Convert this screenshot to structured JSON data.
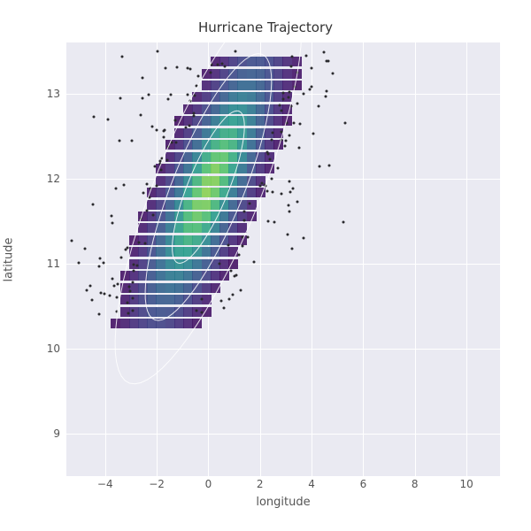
{
  "chart_data": {
    "type": "heatmap",
    "title": "Hurricane Trajectory",
    "xlabel": "longitude",
    "ylabel": "latitude",
    "xlim": [
      -5.5,
      11.3
    ],
    "ylim": [
      8.5,
      13.6
    ],
    "xticks": [
      -4,
      -2,
      0,
      2,
      4,
      6,
      8,
      10
    ],
    "yticks": [
      9,
      10,
      11,
      12,
      13
    ],
    "density_center": {
      "x": 0.0,
      "y": 11.9
    },
    "density_major_axis_angle_deg": 30,
    "density_half_extent": {
      "x": 3.0,
      "y": 0.9
    },
    "contours": 3,
    "colormap": "viridis"
  },
  "title": "Hurricane Trajectory",
  "xlabel": "longitude",
  "ylabel": "latitude",
  "xticks": [
    "−4",
    "−2",
    "0",
    "2",
    "4",
    "6",
    "8",
    "10"
  ],
  "yticks": [
    "9",
    "10",
    "11",
    "12",
    "13"
  ]
}
